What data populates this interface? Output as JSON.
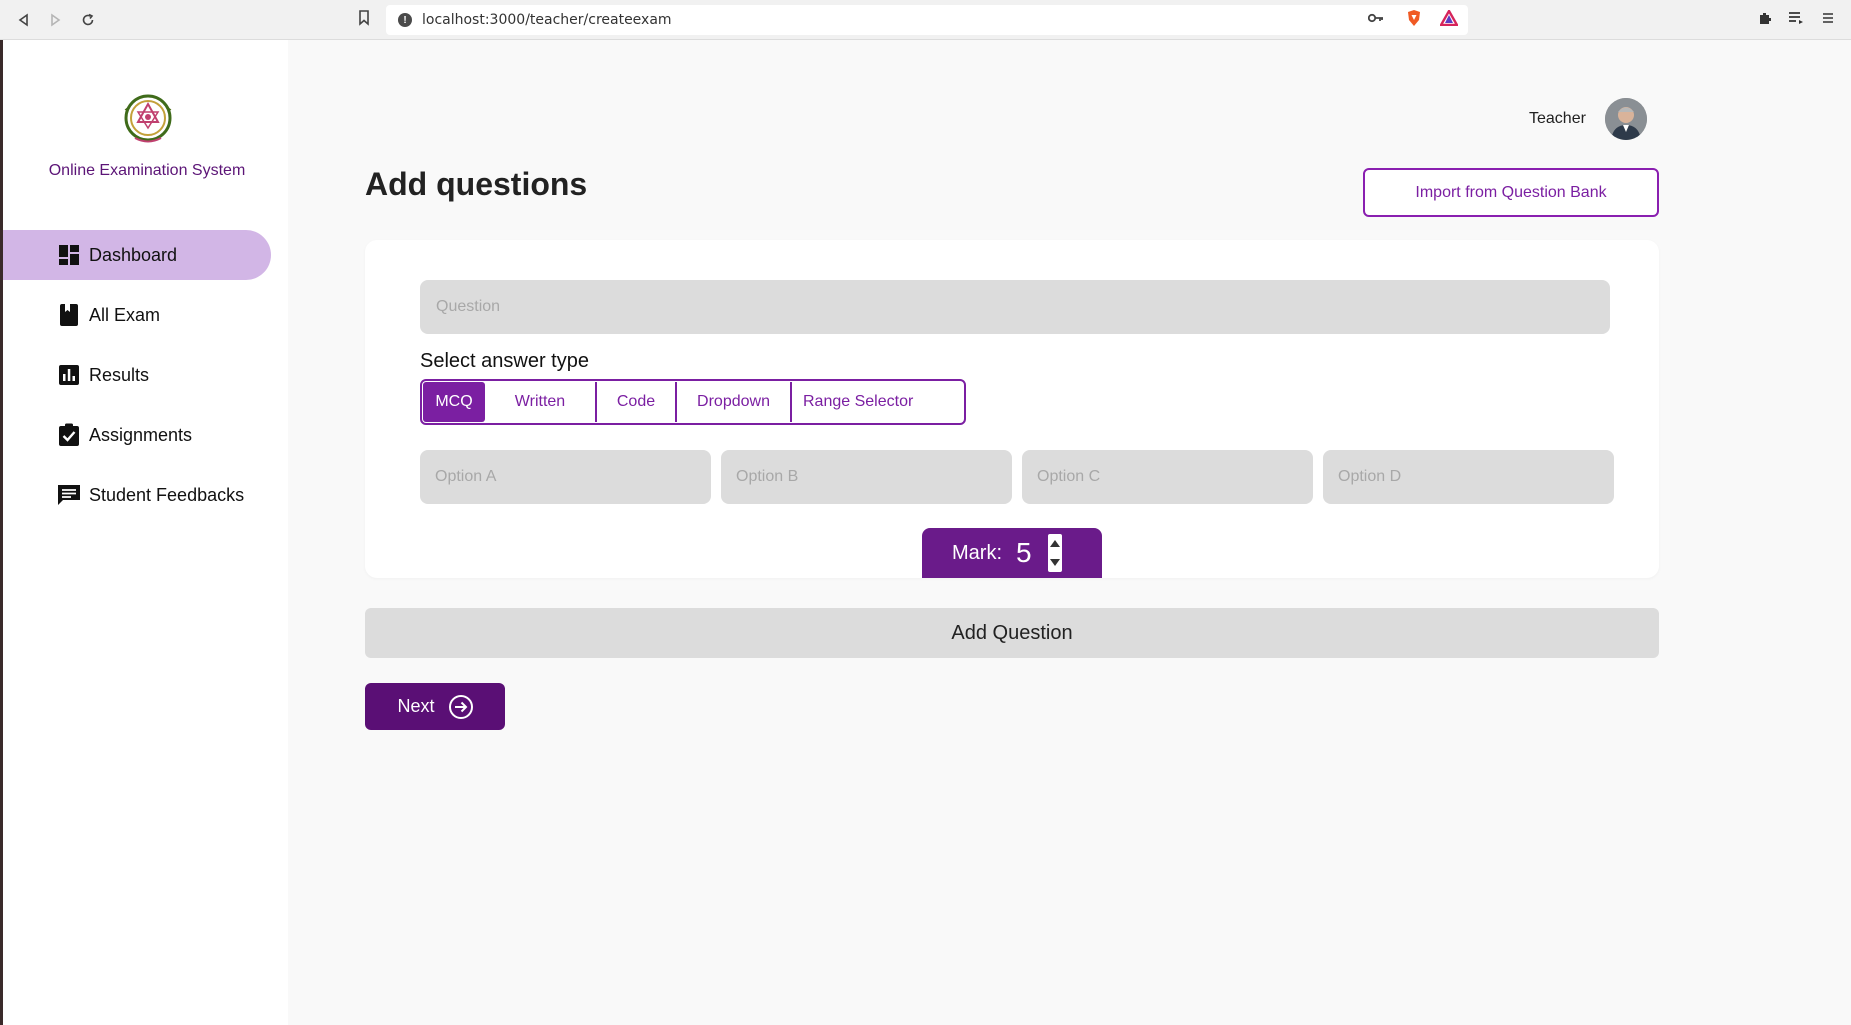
{
  "browser": {
    "url": "localhost:3000/teacher/createexam"
  },
  "sidebar": {
    "brand": "Online Examination System",
    "items": [
      {
        "label": "Dashboard",
        "icon": "dashboard-icon",
        "active": true
      },
      {
        "label": "All Exam",
        "icon": "book-icon",
        "active": false
      },
      {
        "label": "Results",
        "icon": "bar-chart-icon",
        "active": false
      },
      {
        "label": "Assignments",
        "icon": "assignment-check-icon",
        "active": false
      },
      {
        "label": "Student Feedbacks",
        "icon": "feedback-icon",
        "active": false
      }
    ]
  },
  "header": {
    "user_role": "Teacher",
    "page_title": "Add questions",
    "import_label": "Import from Question Bank"
  },
  "form": {
    "question_placeholder": "Question",
    "answer_type_label": "Select answer type",
    "answer_types": [
      "MCQ",
      "Written",
      "Code",
      "Dropdown",
      "Range Selector"
    ],
    "selected_answer_type": "MCQ",
    "options": [
      {
        "placeholder": "Option A"
      },
      {
        "placeholder": "Option B"
      },
      {
        "placeholder": "Option C"
      },
      {
        "placeholder": "Option D"
      }
    ],
    "mark_label": "Mark:",
    "mark_value": "5"
  },
  "actions": {
    "add_question_label": "Add Question",
    "next_label": "Next"
  },
  "colors": {
    "accent": "#7b1fa2",
    "accent_dark": "#5a0f75",
    "sidebar_active": "#d2b6e6",
    "input_bg": "#dcdcdc",
    "page_bg": "#f9f9f9"
  }
}
